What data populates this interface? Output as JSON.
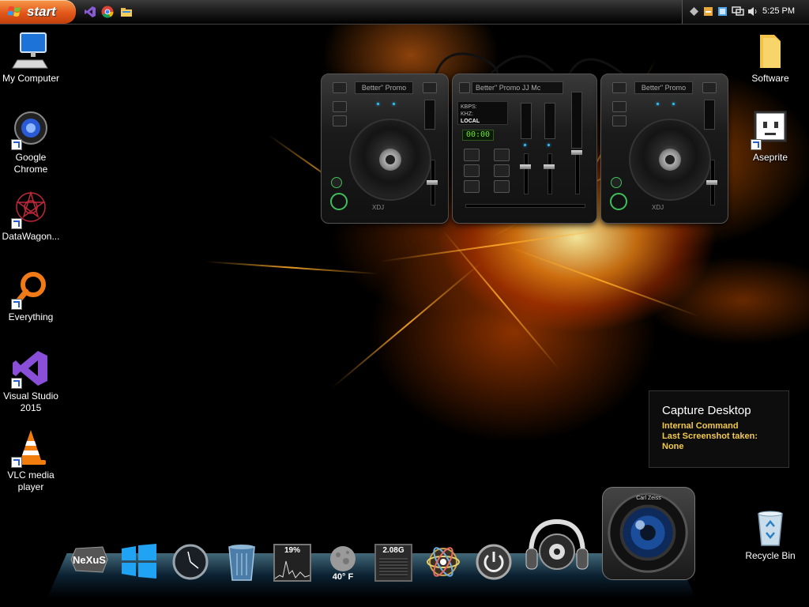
{
  "taskbar": {
    "start_label": "start",
    "clock": "5:25 PM",
    "quick_launch": [
      "visual-studio-icon",
      "chrome-icon",
      "folder-icon"
    ],
    "tray_icons": [
      "network-diamond-icon",
      "tool-icon",
      "window-icon",
      "monitor-icon",
      "network-icon",
      "speaker-icon"
    ]
  },
  "desktop_icons_left": [
    {
      "label": "My Computer",
      "icon": "computer-icon"
    },
    {
      "label": "Google Chrome",
      "icon": "chrome-icon"
    },
    {
      "label": "DataWagon...",
      "icon": "datawagon-icon"
    },
    {
      "label": "Everything",
      "icon": "search-icon"
    },
    {
      "label": "Visual Studio 2015",
      "icon": "visual-studio-icon"
    },
    {
      "label": "VLC media player",
      "icon": "vlc-cone-icon"
    }
  ],
  "desktop_icons_right": [
    {
      "label": "Software",
      "icon": "folder-icon"
    },
    {
      "label": "Aseprite",
      "icon": "aseprite-icon"
    },
    {
      "label": "Recycle Bin",
      "icon": "recycle-bin-icon"
    }
  ],
  "dj_widget": {
    "left_deck_title": "Better\" Promo",
    "right_deck_title": "Better\" Promo",
    "mixer_title": "Better\" Promo   JJ Mc",
    "mixer_info_lines": [
      "KBPS:",
      "KHZ:",
      "LOCAL"
    ],
    "mixer_time": "00:00",
    "deck_brand": "XDJ"
  },
  "capture_tooltip": {
    "title": "Capture Desktop",
    "line1": "Internal Command",
    "line2": "Last Screenshot taken:",
    "line3": "None"
  },
  "dock": {
    "cpu_percent": "19%",
    "temperature": "40° F",
    "memory": "2.08G",
    "lens_text_top": "Carl Zeiss",
    "items": [
      "nexus-logo-icon",
      "windows-start-icon",
      "clock-gauge-icon",
      "recycle-bin-icon",
      "cpu-graph-icon",
      "weather-moon-icon",
      "memory-meter-icon",
      "atom-icon",
      "power-icon",
      "headphones-icon",
      "camera-lens-icon"
    ]
  },
  "colors": {
    "start_orange": "#e2571a",
    "tooltip_accent": "#f2c94c",
    "deck_led_blue": "#2ec3ff",
    "play_green": "#3fbf5a"
  }
}
